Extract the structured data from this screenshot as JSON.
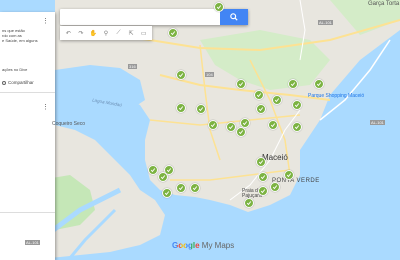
{
  "colors": {
    "water": "#aadaff",
    "land": "#e8e6df",
    "road": "#fde293",
    "park": "#c5e7b7",
    "pin": "#7cb342",
    "accent": "#4285f4"
  },
  "panel": {
    "lines": [
      "ns que estão",
      "rdo com as",
      "e Saúde, em alguns",
      "",
      "",
      "ações no Dive",
      "",
      "Compartilhar"
    ]
  },
  "search": {
    "placeholder": "",
    "icon": "search-icon"
  },
  "toolbar": {
    "tools": [
      "undo-icon",
      "redo-icon",
      "hand-icon",
      "marker-icon",
      "line-icon",
      "directions-icon",
      "ruler-icon"
    ]
  },
  "map_labels": {
    "city": "Maceió",
    "garca_torta": "Garça Torta",
    "lagoa": "Lagoa Mundaú",
    "coqueiro": "Coqueiro Seco",
    "shopping": "Parque Shopping Maceió",
    "ponta_verde": "PONTA VERDE",
    "praia": "Praia de Pajuçara",
    "route_1": "AL-101",
    "route_2": "AL-101",
    "route_3": "104",
    "route_4": "316",
    "route_5": "AL-101"
  },
  "footer": {
    "google": "Google",
    "mymaps": "My Maps"
  },
  "markers": [
    {
      "name": "marker-1"
    },
    {
      "name": "marker-2"
    },
    {
      "name": "marker-3"
    },
    {
      "name": "marker-4"
    },
    {
      "name": "marker-5"
    },
    {
      "name": "marker-6"
    },
    {
      "name": "marker-7"
    },
    {
      "name": "marker-8"
    },
    {
      "name": "marker-9"
    },
    {
      "name": "marker-10"
    },
    {
      "name": "marker-11"
    },
    {
      "name": "marker-12"
    },
    {
      "name": "marker-13"
    },
    {
      "name": "marker-14"
    },
    {
      "name": "marker-15"
    },
    {
      "name": "marker-16"
    },
    {
      "name": "marker-17"
    },
    {
      "name": "marker-18"
    },
    {
      "name": "marker-19"
    },
    {
      "name": "marker-20"
    },
    {
      "name": "marker-21"
    },
    {
      "name": "marker-22"
    },
    {
      "name": "marker-23"
    },
    {
      "name": "marker-24"
    },
    {
      "name": "marker-25"
    },
    {
      "name": "marker-26"
    },
    {
      "name": "marker-27"
    },
    {
      "name": "marker-28"
    },
    {
      "name": "marker-29"
    },
    {
      "name": "marker-30"
    }
  ]
}
